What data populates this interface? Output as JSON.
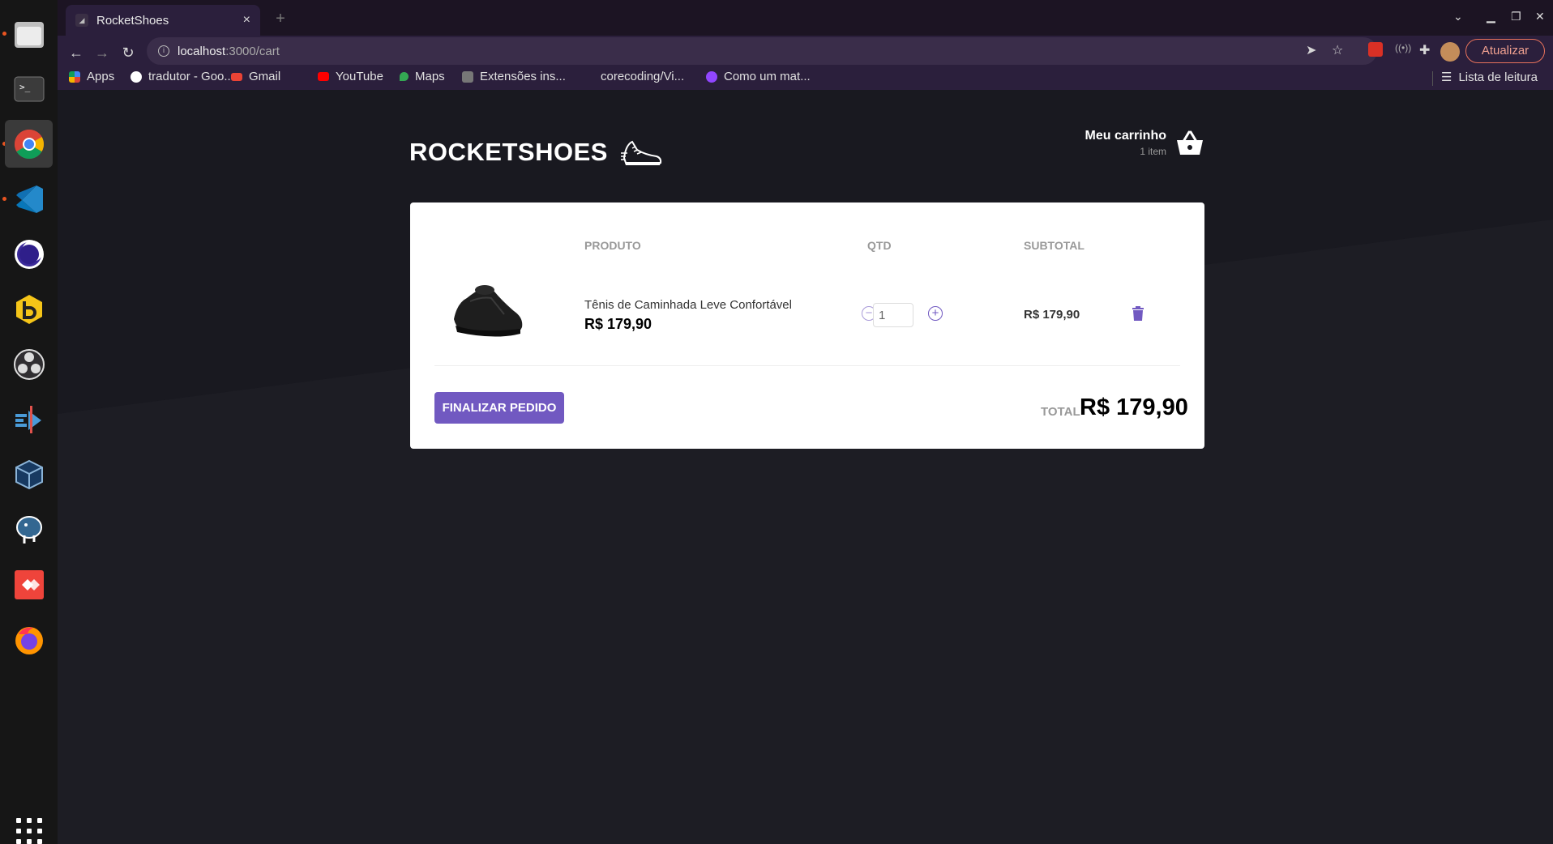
{
  "browser": {
    "tab_title": "RocketShoes",
    "tab_close": "×",
    "url_host": "localhost",
    "url_path": ":3000/cart",
    "update_label": "Atualizar",
    "bookmarks": [
      {
        "label": "Apps"
      },
      {
        "label": "tradutor - Goo..."
      },
      {
        "label": "Gmail"
      },
      {
        "label": "YouTube"
      },
      {
        "label": "Maps"
      },
      {
        "label": "Extensões ins..."
      },
      {
        "label": "corecoding/Vi..."
      },
      {
        "label": "Como um mat..."
      }
    ],
    "reading_list": "Lista de leitura"
  },
  "dock": {
    "apps": [
      "files-icon",
      "terminal-icon",
      "chrome-icon",
      "vscode-icon",
      "eclipse-icon",
      "beekeeper-icon",
      "obs-icon",
      "insomnia-icon",
      "virtualbox-icon",
      "postgres-icon",
      "anydesk-icon",
      "firefox-icon"
    ]
  },
  "header": {
    "logo": "ROCKETSHOES",
    "cart_title": "Meu carrinho",
    "cart_count": "1 item"
  },
  "cart": {
    "columns": {
      "product": "PRODUTO",
      "qty": "QTD",
      "subtotal": "SUBTOTAL"
    },
    "items": [
      {
        "name": "Tênis de Caminhada Leve Confortável",
        "price": "R$ 179,90",
        "quantity": "1",
        "subtotal": "R$ 179,90"
      }
    ],
    "checkout_label": "FINALIZAR PEDIDO",
    "total_label": "TOTAL",
    "total_value": "R$ 179,90"
  },
  "colors": {
    "accent": "#7159c1",
    "background": "#191920"
  }
}
